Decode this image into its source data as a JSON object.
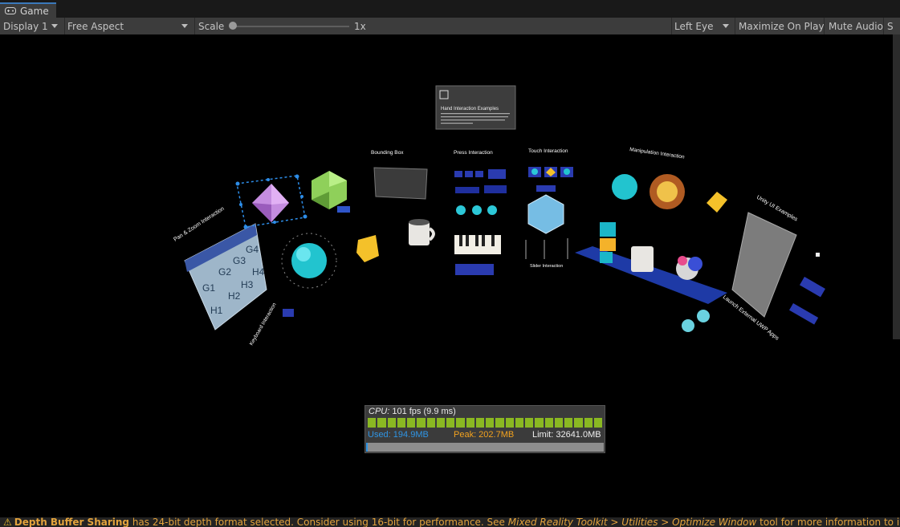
{
  "tab": {
    "title": "Game",
    "icon": "gamepad-icon"
  },
  "toolbar": {
    "display": "Display 1",
    "aspect": "Free Aspect",
    "scale_label": "Scale",
    "scale_value": "1x",
    "eye": "Left Eye",
    "maximize": "Maximize On Play",
    "mute": "Mute Audio",
    "stats": "S"
  },
  "scene": {
    "main_title": "Hand Interaction Examples",
    "pan_zoom": "Pan & Zoom Interaction",
    "bounding_box": "Bounding Box",
    "press": "Press Interaction",
    "touch": "Touch Interaction",
    "manipulation": "Manipulation Interaction",
    "unity_ui": "Unity UI Examples",
    "keyboard": "Keyboard Interaction",
    "slider": "Slider Interaction",
    "launch": "Launch External UWP Apps",
    "grid_cells": [
      "G1",
      "G2",
      "G3",
      "G4",
      "H1",
      "H2",
      "H3",
      "H4"
    ]
  },
  "profiler": {
    "cpu_label": "CPU:",
    "cpu_value": "101 fps (9.9 ms)",
    "used": "Used: 194.9MB",
    "peak": "Peak: 202.7MB",
    "limit": "Limit: 32641.0MB",
    "frame_bars": 24
  },
  "status": {
    "bold": "Depth Buffer Sharing",
    "text1": " has 24-bit depth format selected. Consider using 16-bit for performance. See ",
    "path1": "Mixed Reality Toolkit",
    "gt1": " > ",
    "path2": "Utilities",
    "gt2": " > ",
    "path3": "Optimize Window",
    "text2": " tool for more information to improve performance"
  },
  "colors": {
    "accent": "#3a79bb",
    "fps_bar": "#8ab822",
    "used": "#2f95e5",
    "peak": "#f3a21e",
    "warning": "#e3a33c"
  }
}
